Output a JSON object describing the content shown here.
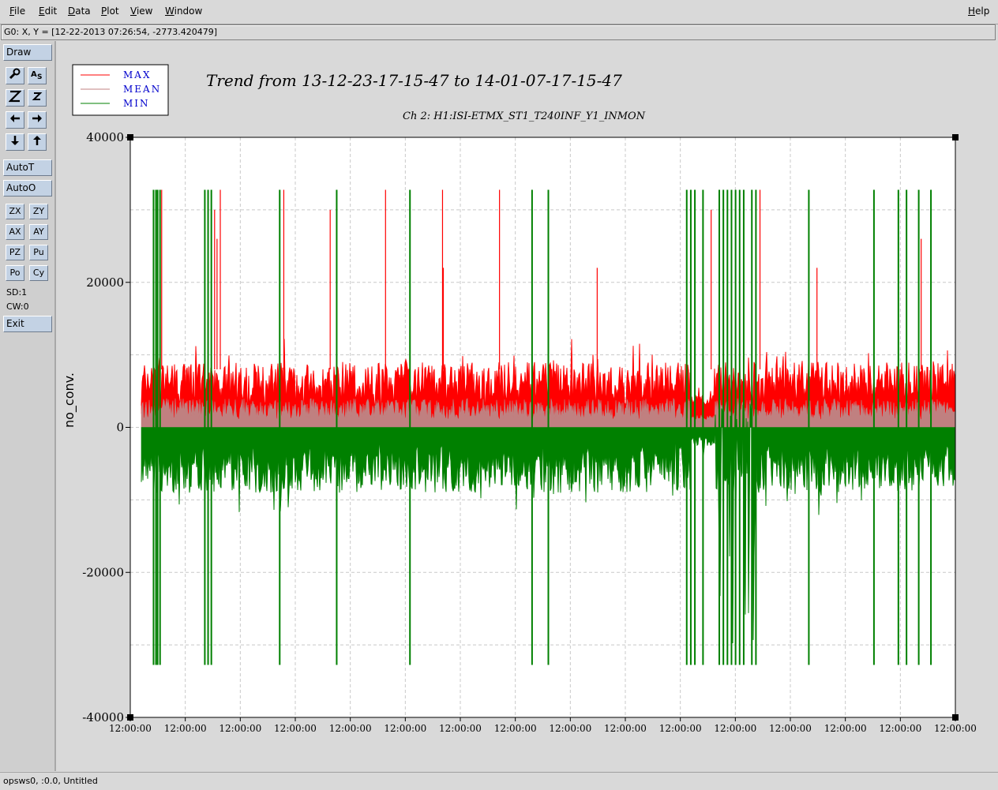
{
  "menu": {
    "file": "File",
    "edit": "Edit",
    "data": "Data",
    "plot": "Plot",
    "view": "View",
    "window": "Window",
    "help": "Help"
  },
  "coord_readout": "G0: X, Y = [12-22-2013 07:26:54, -2773.420479]",
  "toolbar": {
    "draw": "Draw",
    "autot": "AutoT",
    "autoo": "AutoO",
    "zx": "ZX",
    "zy": "ZY",
    "ax": "AX",
    "ay": "AY",
    "pz": "PZ",
    "pu": "Pu",
    "po": "Po",
    "cy": "Cy",
    "sd": "SD:1",
    "cw": "CW:0",
    "exit": "Exit"
  },
  "status": "opsws0, :0.0, Untitled",
  "colors": {
    "max": "#ff0000",
    "mean": "#c08080",
    "min": "#008000",
    "legend_text": "#0000cc",
    "grid": "#c8c8c8"
  },
  "chart_data": {
    "type": "line",
    "title": "Trend from 13-12-23-17-15-47 to 14-01-07-17-15-47",
    "subtitle": "Ch 2: H1:ISI-ETMX_ST1_T240INF_Y1_INMON",
    "ylabel": "no_conv.",
    "xlabel": "",
    "ylim": [
      -40000,
      40000
    ],
    "yticks": [
      40000,
      20000,
      0,
      -20000,
      -40000
    ],
    "ytick_labels": [
      "40000",
      "20000",
      "0",
      "-20000",
      "-40000"
    ],
    "xtick_labels": [
      "12:00:00",
      "12:00:00",
      "12:00:00",
      "12:00:00",
      "12:00:00",
      "12:00:00",
      "12:00:00",
      "12:00:00",
      "12:00:00",
      "12:00:00",
      "12:00:00",
      "12:00:00",
      "12:00:00",
      "12:00:00",
      "12:00:00",
      "12:00:00"
    ],
    "x": [
      0,
      1,
      2,
      3,
      4,
      5,
      6,
      7,
      8,
      9,
      10,
      11,
      12,
      13,
      14,
      15
    ],
    "xlim": [
      0,
      15
    ],
    "grid": true,
    "legend_position": "top-left",
    "series": [
      {
        "name": "MAX",
        "envelope": [
          3000,
          9000
        ],
        "spikes": [
          32767,
          30000,
          26000,
          22000
        ]
      },
      {
        "name": "MEAN",
        "envelope": [
          1000,
          4000
        ],
        "spikes": []
      },
      {
        "name": "MIN",
        "envelope": [
          -9000,
          -2000
        ],
        "spikes": [
          -32768,
          -22000,
          -18000
        ]
      }
    ]
  }
}
